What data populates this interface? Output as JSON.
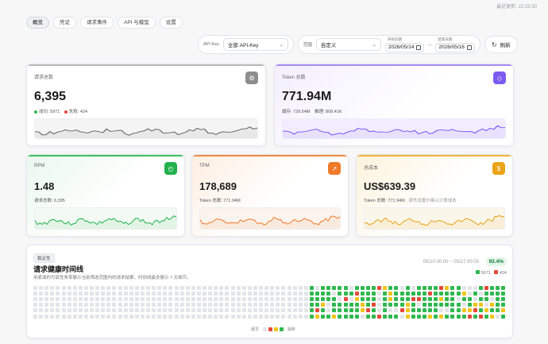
{
  "header": {
    "last_update": "最近更新: 22:23:30"
  },
  "tabs": [
    {
      "label": "概览",
      "active": true
    },
    {
      "label": "凭证",
      "active": false
    },
    {
      "label": "请求事件",
      "active": false
    },
    {
      "label": "API 与模型",
      "active": false
    },
    {
      "label": "设置",
      "active": false
    }
  ],
  "filters": {
    "apikey_label": "API Key",
    "apikey_value": "全部 API-Key",
    "range_label": "范围",
    "range_value": "自定义",
    "start_label": "开始日期",
    "start_value": "2026/05/14",
    "end_label": "结束日期",
    "end_value": "2026/05/16",
    "refresh_label": "刷新"
  },
  "cards": {
    "requests": {
      "label": "请求总数",
      "value": "6,395",
      "success": "成功: 5971",
      "failure": "失败: 424",
      "color": "#9a9a9a"
    },
    "tokens": {
      "label": "Token 总数",
      "value": "771.94M",
      "cache": "缓存: 729.64M",
      "reasoning": "推理: 808.41K",
      "color": "#7c5cf0"
    },
    "rpm": {
      "label": "RPM",
      "value": "1.48",
      "sub": "请求总数: 6,395",
      "color": "#22b14c"
    },
    "tpm": {
      "label": "TPM",
      "value": "178,689",
      "sub": "Token 总数: 771.94M",
      "color": "#ef7a2a"
    },
    "cost": {
      "label": "总成本",
      "value": "US$639.39",
      "sub": "Token 总数: 771.94M",
      "hint": "请先设置价格以计算成本",
      "color": "#e8a317"
    }
  },
  "health": {
    "badge": "稳定性",
    "title": "请求健康时间线",
    "description": "用紧凑的可靠性条带展示当前筛选范围内的请求结果，时间线最多展示 7 天细节。",
    "range": "05/10 00:00 ~ 05/17 00:00",
    "rate": "93.4%",
    "success_count": "5971",
    "failure_count": "424",
    "legend_left": "最早",
    "legend_right": "最新"
  },
  "colors": {
    "success": "#2fb84f",
    "warn": "#f0c419",
    "fail": "#e5483b",
    "empty": "#e3e4e7"
  }
}
